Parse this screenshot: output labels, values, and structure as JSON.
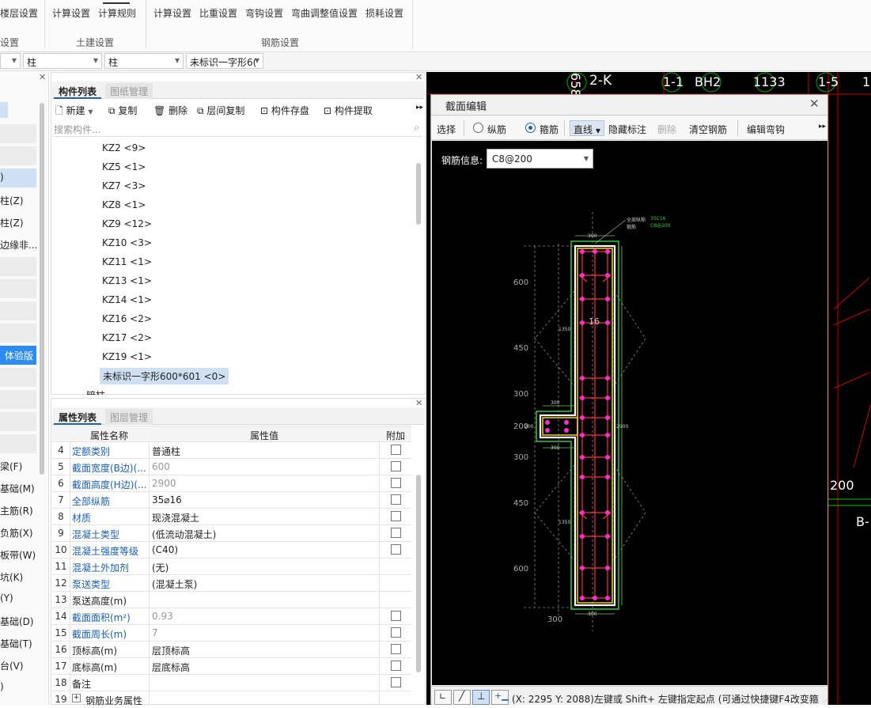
{
  "ribbon": {
    "items": [
      "楼层设置",
      "计算设置",
      "计算规则",
      "计算设置",
      "比重设置",
      "弯钩设置",
      "弯曲调整值设置",
      "损耗设置"
    ],
    "groups": [
      "设置",
      "土建设置",
      "钢筋设置"
    ]
  },
  "selectors": [
    "柱",
    "柱",
    "未标识一字形6("
  ],
  "left_strip": {
    "items": [
      ")",
      "柱(Z)",
      "柱(Z)",
      "边缘非...",
      "体验版",
      "梁(F)",
      "基础(M)",
      "主筋(R)",
      "负筋(X)",
      "板带(W)",
      "坑(K)",
      "(Y)",
      "基础(D)",
      "基础(T)",
      "台(V)",
      ")"
    ]
  },
  "component_panel": {
    "tabs": [
      "构件列表",
      "图纸管理"
    ],
    "toolbar": [
      "新建",
      "复制",
      "删除",
      "层间复制",
      "构件存盘",
      "构件提取"
    ],
    "search_placeholder": "搜索构件...",
    "items": [
      "KZ2 <9>",
      "KZ5 <1>",
      "KZ7 <3>",
      "KZ8 <1>",
      "KZ9 <12>",
      "KZ10 <3>",
      "KZ11 <1>",
      "KZ13 <1>",
      "KZ14 <1>",
      "KZ16 <2>",
      "KZ17 <2>",
      "KZ19 <1>",
      "未标识一字形600*601 <0>"
    ],
    "partial_item": "暗柱"
  },
  "property_panel": {
    "tabs": [
      "属性列表",
      "图层管理"
    ],
    "headers": [
      "属性名称",
      "属性值",
      "附加"
    ],
    "rows": [
      {
        "n": "4",
        "name": "定额类别",
        "value": "普通柱"
      },
      {
        "n": "5",
        "name": "截面宽度(B边)(...",
        "value": "600"
      },
      {
        "n": "6",
        "name": "截面高度(H边)(...",
        "value": "2900"
      },
      {
        "n": "7",
        "name": "全部纵筋",
        "value": "35⌀16"
      },
      {
        "n": "8",
        "name": "材质",
        "value": "现浇混凝土"
      },
      {
        "n": "9",
        "name": "混凝土类型",
        "value": "(低流动混凝土)"
      },
      {
        "n": "10",
        "name": "混凝土强度等级",
        "value": "(C40)"
      },
      {
        "n": "11",
        "name": "混凝土外加剂",
        "value": "(无)"
      },
      {
        "n": "12",
        "name": "泵送类型",
        "value": "(混凝土泵)"
      },
      {
        "n": "13",
        "name": "泵送高度(m)",
        "value": ""
      },
      {
        "n": "14",
        "name": "截面面积(m²)",
        "value": "0.93"
      },
      {
        "n": "15",
        "name": "截面周长(m)",
        "value": "7"
      },
      {
        "n": "16",
        "name": "顶标高(m)",
        "value": "层顶标高"
      },
      {
        "n": "17",
        "name": "底标高(m)",
        "value": "层底标高"
      },
      {
        "n": "18",
        "name": "备注",
        "value": ""
      },
      {
        "n": "19",
        "name": "钢筋业务属性",
        "value": ""
      }
    ]
  },
  "cad_bg": {
    "labels": [
      "658",
      "2-K",
      "1-1",
      "BH2",
      "1133",
      "1-5",
      "1",
      "200",
      "B-"
    ]
  },
  "dialog": {
    "title": "截面编辑",
    "toolbar": {
      "select": "选择",
      "longitudinal": "纵筋",
      "stirrup": "箍筋",
      "line": "直线",
      "hide_mark": "隐藏标注",
      "delete": "删除",
      "clear": "清空钢筋",
      "edit_hook": "编辑弯钩"
    },
    "rebar_info_label": "钢筋信息:",
    "rebar_info_value": "C8@200",
    "status_text": "(X: 2295 Y: 2088)左键或 Shift+ 左键指定起点 (可通过快捷键F4改变箍"
  },
  "section": {
    "legend": [
      "全部纵筋",
      "35C16",
      "箍筋",
      "C8@200"
    ],
    "dims_left": [
      "600",
      "450",
      "300",
      "200",
      "300",
      "450",
      "600"
    ],
    "dims_other": [
      "300",
      "300",
      "300",
      "300",
      "200",
      "1350",
      "1350",
      "2900",
      "16",
      "300"
    ]
  },
  "colors": {
    "link": "#1a5fb4",
    "highlight": "#cfe0f4",
    "cad_bg": "#000000"
  }
}
